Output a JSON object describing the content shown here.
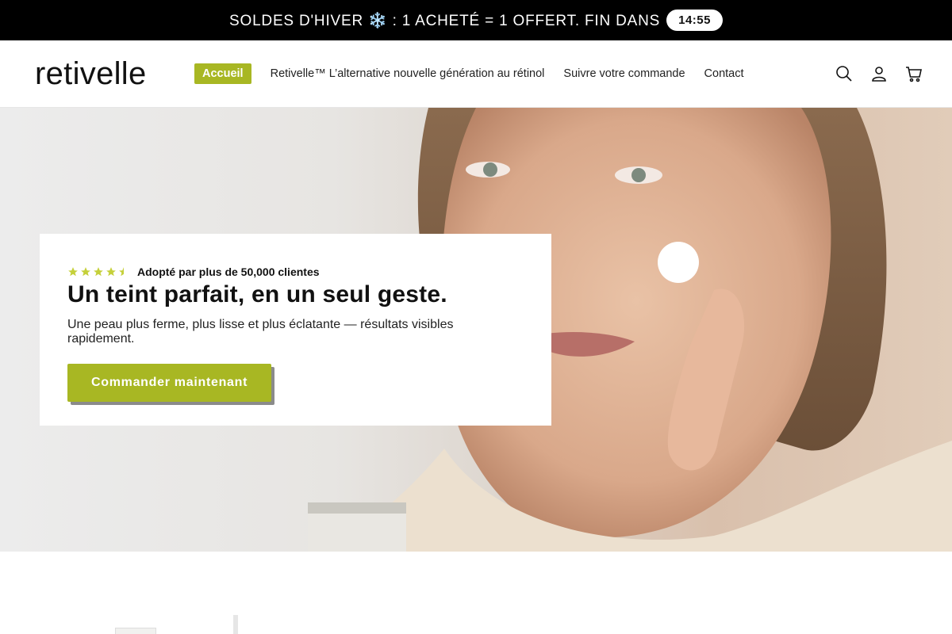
{
  "announcement": {
    "text": "SOLDES D'HIVER ❄️ : 1 ACHETÉ = 1 OFFERT. FIN DANS",
    "timer": "14:55"
  },
  "header": {
    "logo": "retivelle",
    "nav": [
      {
        "label": "Accueil",
        "active": true
      },
      {
        "label": "Retivelle™ L’alternative nouvelle génération au rétinol",
        "active": false
      },
      {
        "label": "Suivre votre commande",
        "active": false
      },
      {
        "label": "Contact",
        "active": false
      }
    ],
    "icons": [
      "search-icon",
      "account-icon",
      "cart-icon"
    ]
  },
  "hero": {
    "rating": {
      "stars": 4.5,
      "text": "Adopté par plus de 50,000 clientes"
    },
    "headline": "Un teint parfait, en un seul geste.",
    "subline": "Une peau plus ferme, plus lisse et plus éclatante — résultats visibles rapidement.",
    "cta": "Commander maintenant"
  },
  "colors": {
    "accent": "#a8b723",
    "announcement_bg": "#000000",
    "star": "#c5d03a"
  }
}
